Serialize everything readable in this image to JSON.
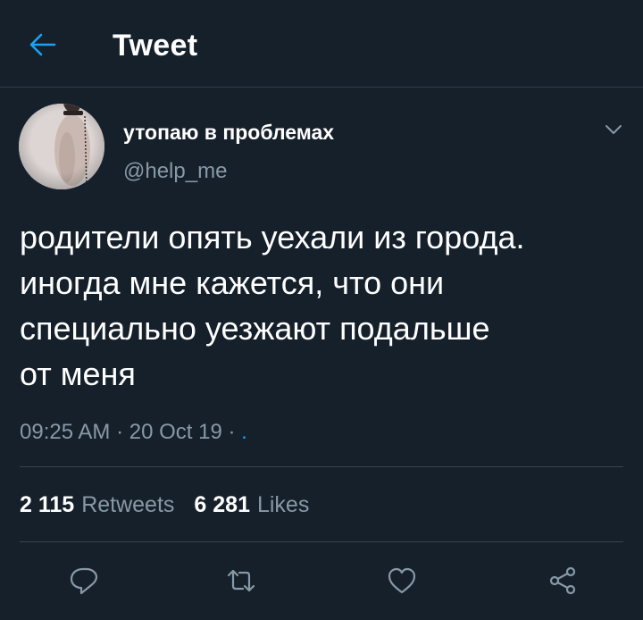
{
  "header": {
    "title": "Tweet",
    "back_icon": "arrow-left-icon",
    "accent_color": "#1da1f2"
  },
  "author": {
    "display_name": "утопаю в проблемах",
    "handle": "@help_me"
  },
  "tweet": {
    "text": "родители опять уехали из города.\nиногда мне кажется, что они\nспециально уезжают подальше\nот меня",
    "time": "09:25 AM",
    "date": "20 Oct 19",
    "separator": "·",
    "app_link": "."
  },
  "stats": {
    "retweets_count": "2 115",
    "retweets_label": "Retweets",
    "likes_count": "6 281",
    "likes_label": "Likes"
  },
  "actions": [
    "reply-icon",
    "retweet-icon",
    "like-icon",
    "share-icon"
  ],
  "colors": {
    "background": "#15202b",
    "secondary_text": "#8899a6",
    "divider": "#38444d"
  }
}
